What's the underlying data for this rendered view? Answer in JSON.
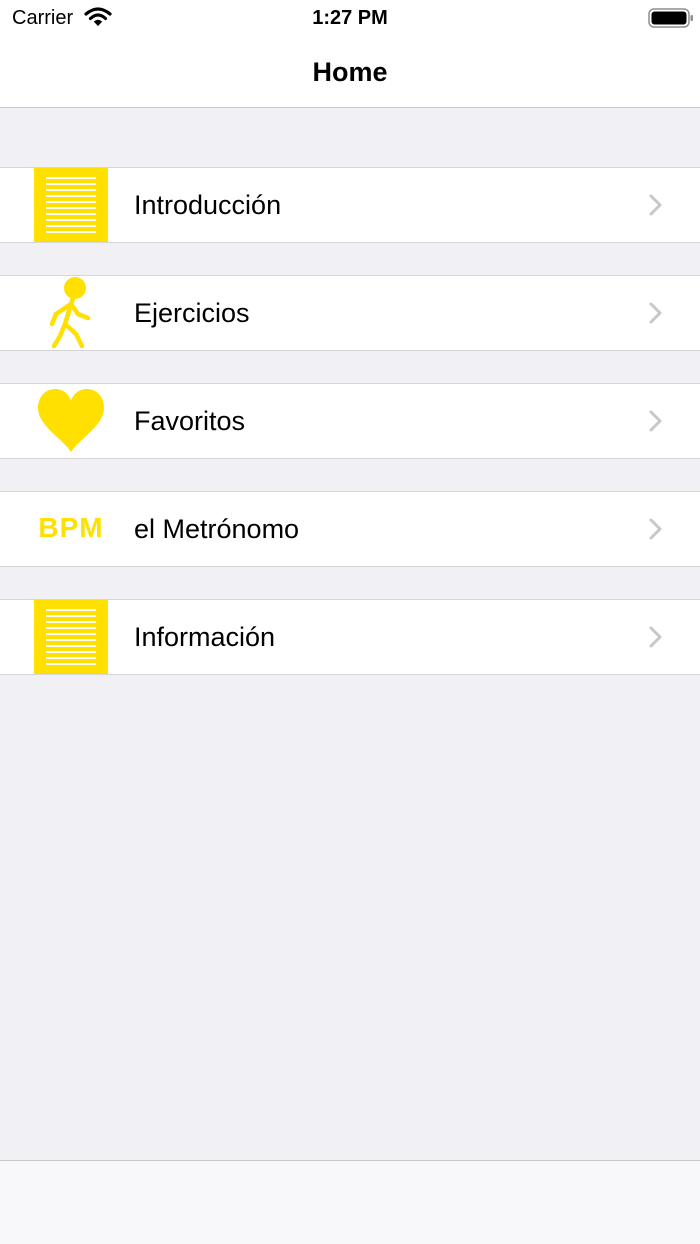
{
  "status_bar": {
    "carrier": "Carrier",
    "time": "1:27 PM",
    "icons": [
      "wifi-icon",
      "battery-icon"
    ]
  },
  "nav": {
    "title": "Home"
  },
  "colors": {
    "accent": "#ffe000",
    "background": "#f0f0f5",
    "chevron": "#c7c7cc"
  },
  "menu": {
    "items": [
      {
        "label": "Introducción",
        "icon": "document-lines-icon"
      },
      {
        "label": "Ejercicios",
        "icon": "walking-person-icon"
      },
      {
        "label": "Favoritos",
        "icon": "heart-icon"
      },
      {
        "label": "el Metrónomo",
        "icon": "bpm-icon",
        "icon_text": "BPM"
      },
      {
        "label": "Información",
        "icon": "document-lines-icon"
      }
    ]
  }
}
